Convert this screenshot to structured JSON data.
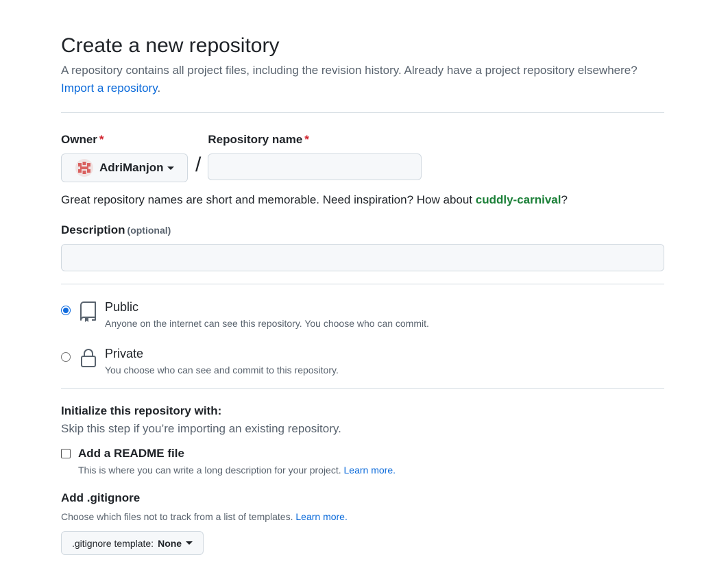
{
  "header": {
    "title": "Create a new repository",
    "subtitle": "A repository contains all project files, including the revision history. Already have a project repository elsewhere?",
    "import_link": "Import a repository",
    "import_suffix": "."
  },
  "owner": {
    "label": "Owner",
    "required_mark": "*",
    "selected": "AdriManjon",
    "avatar_icon": "user-avatar-identicon"
  },
  "separator": "/",
  "repo_name": {
    "label": "Repository name",
    "required_mark": "*",
    "value": "",
    "placeholder": ""
  },
  "name_hint": {
    "text": "Great repository names are short and memorable. Need inspiration? How about ",
    "suggestion": "cuddly-carnival",
    "suffix": "?"
  },
  "description": {
    "label": "Description",
    "optional": "(optional)",
    "value": "",
    "placeholder": ""
  },
  "visibility": {
    "options": [
      {
        "title": "Public",
        "desc": "Anyone on the internet can see this repository. You choose who can commit.",
        "icon": "repo-icon",
        "checked": true
      },
      {
        "title": "Private",
        "desc": "You choose who can see and commit to this repository.",
        "icon": "lock-icon",
        "checked": false
      }
    ]
  },
  "initialize": {
    "title": "Initialize this repository with:",
    "subtitle": "Skip this step if you’re importing an existing repository.",
    "readme": {
      "title": "Add a README file",
      "desc": "This is where you can write a long description for your project.",
      "learn_more": "Learn more.",
      "checked": false
    }
  },
  "gitignore": {
    "title": "Add .gitignore",
    "desc": "Choose which files not to track from a list of templates.",
    "learn_more": "Learn more.",
    "button_prefix": ".gitignore template:",
    "button_value": "None"
  },
  "colors": {
    "link": "#0969da",
    "suggestion": "#1a7f37",
    "required": "#d1242f",
    "radio_checked": "#0f6bde"
  }
}
